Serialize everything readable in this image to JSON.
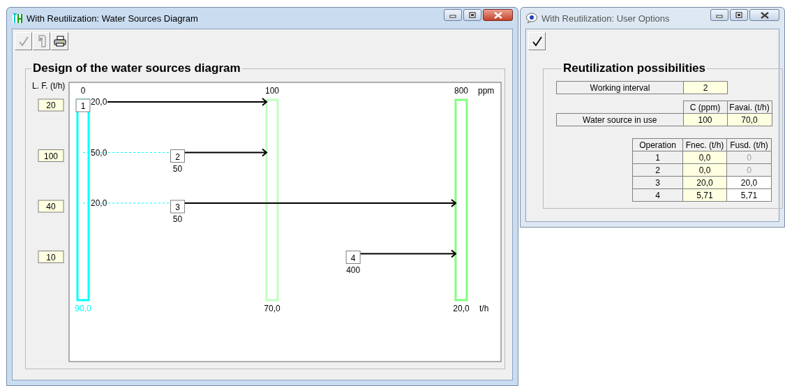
{
  "diagram_window": {
    "title": "With Reutilization: Water Sources Diagram",
    "active": true,
    "toolbar": [
      {
        "kind": "accept",
        "disabled": true
      },
      {
        "kind": "help",
        "disabled": true
      },
      {
        "kind": "print",
        "disabled": false
      }
    ],
    "group_title": "Design of the water sources diagram",
    "diagram": {
      "lf_label": "L. F. (t/h)",
      "concentration_unit": "ppm",
      "flow_unit": "t/h",
      "sources": [
        {
          "concentration": "0",
          "flow": "90,0",
          "color": "#00ffff",
          "flow_highlight": true
        },
        {
          "concentration": "100",
          "flow": "70,0",
          "color": "#c0ffc0",
          "flow_highlight": false
        },
        {
          "concentration": "800",
          "flow": "20,0",
          "color": "#80ff80",
          "flow_highlight": false
        }
      ],
      "operations": [
        {
          "number": "1",
          "lf": "20",
          "supply": "20,0",
          "kind": "middle"
        },
        {
          "number": "2",
          "lf": "100",
          "supply": "50,0",
          "concentration": "50",
          "kind": "middle"
        },
        {
          "number": "3",
          "lf": "40",
          "supply": "20,0",
          "concentration": "50",
          "kind": "last"
        },
        {
          "number": "4",
          "lf": "10",
          "concentration": "400",
          "kind": "last"
        }
      ]
    }
  },
  "options_window": {
    "title": "With Reutilization: User Options",
    "active": false,
    "toolbar": [
      {
        "kind": "accept",
        "disabled": false
      }
    ],
    "group_title": "Reutilization possibilities",
    "working_interval": {
      "label": "Working interval",
      "value": "2"
    },
    "water_source": {
      "columns": [
        "C (ppm)",
        "Favai. (t/h)"
      ],
      "label": "Water source in use",
      "values": [
        "100",
        "70,0"
      ]
    },
    "operations": {
      "columns": [
        "Operation",
        "Fnec. (t/h)",
        "Fusd. (t/h)"
      ],
      "rows": [
        {
          "operation": "1",
          "fnec": "0,0",
          "fusd": "0",
          "disabled": true
        },
        {
          "operation": "2",
          "fnec": "0,0",
          "fusd": "0",
          "disabled": true
        },
        {
          "operation": "3",
          "fnec": "20,0",
          "fusd": "20,0",
          "disabled": false
        },
        {
          "operation": "4",
          "fnec": "5,71",
          "fusd": "5,71",
          "disabled": false
        }
      ]
    }
  }
}
